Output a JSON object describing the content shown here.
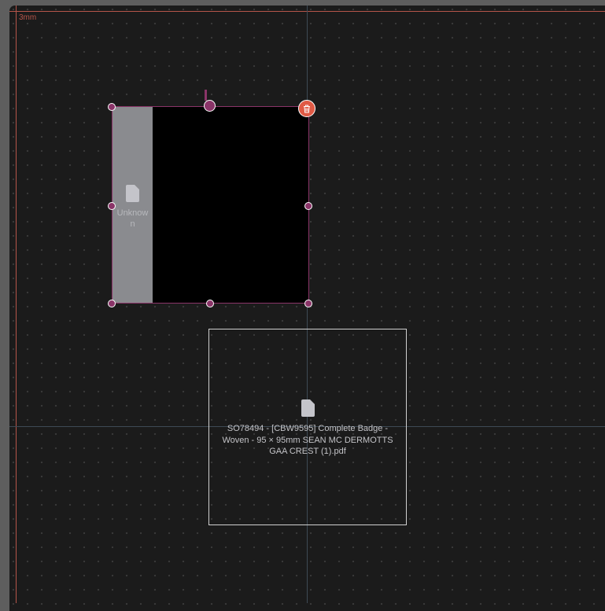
{
  "canvas": {
    "margin_label": "3mm",
    "colors": {
      "margin": "#b5554a",
      "selection": "#8a3468",
      "delete": "#e05a45",
      "guide": "#3e4a55"
    }
  },
  "selected_item": {
    "label": "Unknown",
    "icon": "file-icon",
    "delete_icon": "trash-icon"
  },
  "placeholder_item": {
    "label": "SO78494 - [CBW9595] Complete Badge - Woven - 95 × 95mm SEAN MC DERMOTTS GAA CREST (1).pdf",
    "icon": "file-icon"
  }
}
